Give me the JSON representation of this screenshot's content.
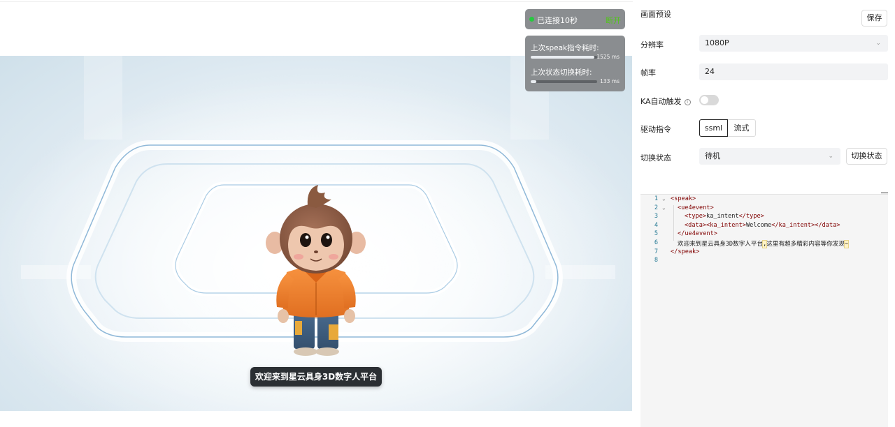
{
  "status": {
    "connected_text": "已连接10秒",
    "disconnect_label": "断开"
  },
  "metrics": [
    {
      "label": "上次speak指令耗时:",
      "value": "1525 ms",
      "fill": 0.96
    },
    {
      "label": "上次状态切换耗时:",
      "value": "133 ms",
      "fill": 0.08
    }
  ],
  "stage": {
    "caption": "欢迎来到星云具身3D数字人平台"
  },
  "panel": {
    "preset_title": "画面预设",
    "save_label": "保存",
    "resolution_label": "分辨率",
    "resolution_value": "1080P",
    "framerate_label": "帧率",
    "framerate_value": "24",
    "ka_label": "KA自动触发",
    "ka_enabled": false,
    "drive_label": "驱动指令",
    "drive_options": [
      "ssml",
      "流式"
    ],
    "drive_selected": "ssml",
    "state_label": "切换状态",
    "state_value": "待机",
    "switch_button": "切换状态"
  },
  "editor": {
    "line_numbers": [
      "1",
      "2",
      "3",
      "4",
      "5",
      "6",
      "7",
      "8"
    ],
    "lines": {
      "l1_open": "<speak>",
      "l2_open": "<ue4event>",
      "l3_open": "<type>",
      "l3_text": "ka_intent",
      "l3_close": "</type>",
      "l4_open1": "<data>",
      "l4_open2": "<ka_intent>",
      "l4_text": "Welcome",
      "l4_close1": "</ka_intent>",
      "l4_close2": "</data>",
      "l5_close": "</ue4event>",
      "l6_text_a": "欢迎来到星云具身3D数字人平台",
      "l6_punct": ",",
      "l6_text_b": "这里有超多精彩内容等你发现",
      "l6_tilde": "~",
      "l7_close": "</speak>"
    }
  }
}
